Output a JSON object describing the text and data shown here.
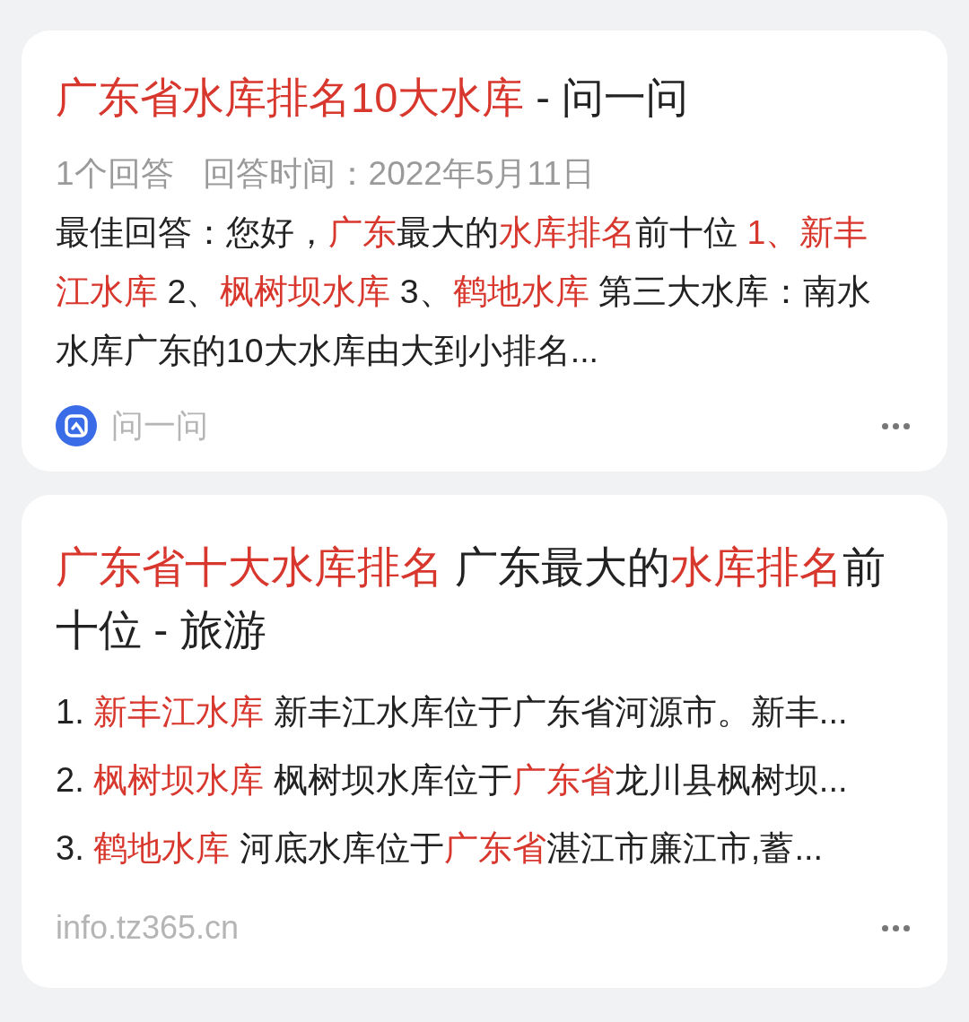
{
  "cards": [
    {
      "title": [
        {
          "text": "广东省水库排名10大水库",
          "highlight": true
        },
        {
          "text": " - 问一问",
          "highlight": false
        }
      ],
      "meta": [
        "1个回答",
        "回答时间：2022年5月11日"
      ],
      "body": [
        {
          "text": "最佳回答：您好，",
          "highlight": false
        },
        {
          "text": "广东",
          "highlight": true
        },
        {
          "text": "最大的",
          "highlight": false
        },
        {
          "text": "水库排名",
          "highlight": true
        },
        {
          "text": "前十位 ",
          "highlight": false
        },
        {
          "text": "1、新丰江水库",
          "highlight": true
        },
        {
          "text": " 2、",
          "highlight": false
        },
        {
          "text": "枫树坝水库",
          "highlight": true
        },
        {
          "text": " 3、",
          "highlight": false
        },
        {
          "text": "鹤地水库",
          "highlight": true
        },
        {
          "text": " 第三大水库：南水水库广东的10大水库由大到小排名...",
          "highlight": false
        }
      ],
      "source": {
        "name": "问一问",
        "kind": "logo"
      }
    },
    {
      "title": [
        {
          "text": "广东省十大水库排名",
          "highlight": true
        },
        {
          "text": " 广东最大的",
          "highlight": false
        },
        {
          "text": "水库排名",
          "highlight": true
        },
        {
          "text": "前十位 - 旅游",
          "highlight": false
        }
      ],
      "items": [
        {
          "number": "1.",
          "parts": [
            {
              "text": "新丰江水库",
              "highlight": true
            },
            {
              "text": " 新丰江水库位于广东省河源市。新丰...",
              "highlight": false
            }
          ]
        },
        {
          "number": "2.",
          "parts": [
            {
              "text": "枫树坝水库",
              "highlight": true
            },
            {
              "text": " 枫树坝水库位于",
              "highlight": false
            },
            {
              "text": "广东省",
              "highlight": true
            },
            {
              "text": "龙川县枫树坝...",
              "highlight": false
            }
          ]
        },
        {
          "number": "3.",
          "parts": [
            {
              "text": "鹤地水库",
              "highlight": true
            },
            {
              "text": " 河底水库位于",
              "highlight": false
            },
            {
              "text": "广东省",
              "highlight": true
            },
            {
              "text": "湛江市廉江市,蓄...",
              "highlight": false
            }
          ]
        }
      ],
      "source": {
        "name": "info.tz365.cn",
        "kind": "plain"
      }
    }
  ]
}
